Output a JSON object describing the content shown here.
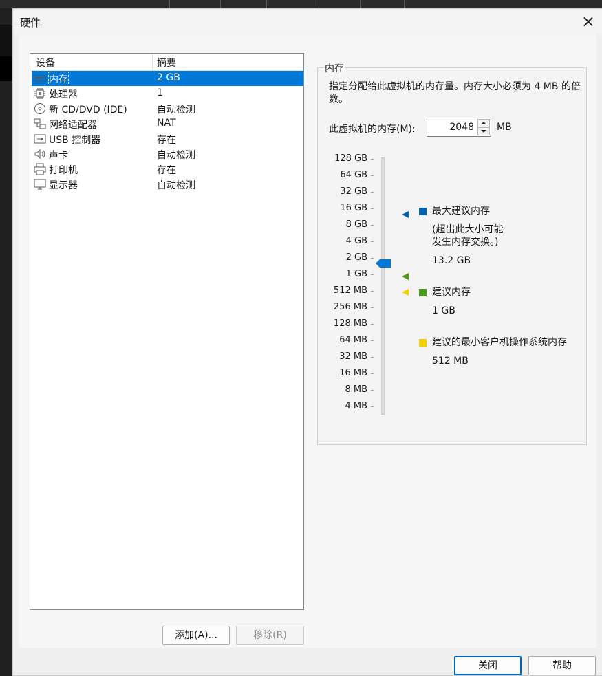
{
  "window": {
    "title": "硬件"
  },
  "device_list": {
    "headers": {
      "device": "设备",
      "summary": "摘要"
    },
    "items": [
      {
        "name": "内存",
        "summary": "2 GB",
        "icon": "memory-icon",
        "selected": true
      },
      {
        "name": "处理器",
        "summary": "1",
        "icon": "processor-icon",
        "selected": false
      },
      {
        "name": "新 CD/DVD (IDE)",
        "summary": "自动检测",
        "icon": "cd-dvd-icon",
        "selected": false
      },
      {
        "name": "网络适配器",
        "summary": "NAT",
        "icon": "network-adapter-icon",
        "selected": false
      },
      {
        "name": "USB 控制器",
        "summary": "存在",
        "icon": "usb-icon",
        "selected": false
      },
      {
        "name": "声卡",
        "summary": "自动检测",
        "icon": "sound-card-icon",
        "selected": false
      },
      {
        "name": "打印机",
        "summary": "存在",
        "icon": "printer-icon",
        "selected": false
      },
      {
        "name": "显示器",
        "summary": "自动检测",
        "icon": "display-icon",
        "selected": false
      }
    ],
    "add_button": "添加(A)...",
    "remove_button": "移除(R)"
  },
  "memory": {
    "group_title": "内存",
    "description": "指定分配给此虚拟机的内存量。内存大小必须为 4 MB 的倍数。",
    "input_label": "此虚拟机的内存(M):",
    "value": "2048",
    "unit": "MB",
    "scale_labels": [
      "128 GB",
      "64 GB",
      "32 GB",
      "16 GB",
      "8 GB",
      "4 GB",
      "2 GB",
      "1 GB",
      "512 MB",
      "256 MB",
      "128 MB",
      "64 MB",
      "32 MB",
      "16 MB",
      "8 MB",
      "4 MB"
    ],
    "current": "2 GB",
    "legend": {
      "max": {
        "label": "最大建议内存",
        "note_line1": "(超出此大小可能",
        "note_line2": "发生内存交换。)",
        "value": "13.2 GB",
        "color": "#0063b1"
      },
      "recommended": {
        "label": "建议内存",
        "value": "1 GB",
        "color": "#4c9a1b"
      },
      "min_guest": {
        "label": "建议的最小客户机操作系统内存",
        "value": "512 MB",
        "color": "#f2d000"
      }
    },
    "thumb_color": "#0078d7"
  },
  "footer": {
    "close_button": "关闭",
    "help_button": "帮助"
  }
}
